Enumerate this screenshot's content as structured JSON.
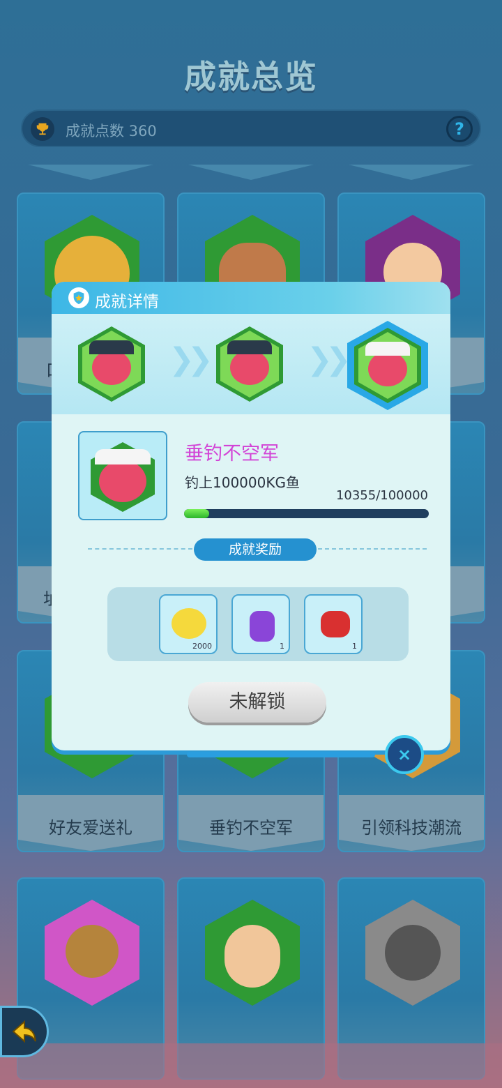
{
  "header": {
    "title": "成就总览",
    "points_label": "成就点数 360",
    "help_label": "?"
  },
  "grid": {
    "row3_labels": [
      "好友爱送礼",
      "垂钓不空军",
      "引领科技潮流"
    ],
    "partial_labels": [
      "口",
      "址"
    ]
  },
  "modal": {
    "title": "成就详情",
    "achievement_name": "垂钓不空军",
    "description": "钓上100000KG鱼",
    "progress_text": "10355/100000",
    "progress_fraction": 0.10355,
    "reward_section_label": "成就奖励",
    "rewards": [
      {
        "icon": "cat-coin-icon",
        "quantity": "2000"
      },
      {
        "icon": "purple-potion-icon",
        "quantity": "1"
      },
      {
        "icon": "red-potion-icon",
        "quantity": "1"
      }
    ],
    "status_button": "未解锁",
    "close_label": "×"
  },
  "colors": {
    "accent": "#2591d0",
    "name_color": "#d244d6",
    "progress": "#2bb52b"
  }
}
